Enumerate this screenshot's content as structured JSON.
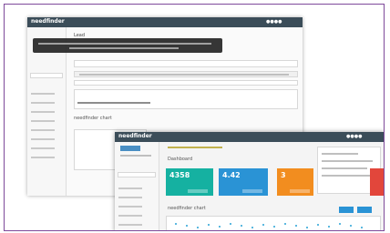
{
  "back_window": {
    "brand": "needfinder",
    "title": "Lead",
    "dashboard_section": "needfinder chart"
  },
  "front_window": {
    "brand": "needfinder",
    "title": "Dashboard",
    "tiles": [
      {
        "value": "4358",
        "color": "#15b1a1"
      },
      {
        "value": "4.42",
        "color": "#2a93d5"
      },
      {
        "value": "3",
        "color": "#f28d1f"
      }
    ],
    "chart_section": "needfinder chart"
  },
  "colors": {
    "frame": "#7e4a9a",
    "topbar": "#3b4d59",
    "accent": "#29a3d6"
  }
}
